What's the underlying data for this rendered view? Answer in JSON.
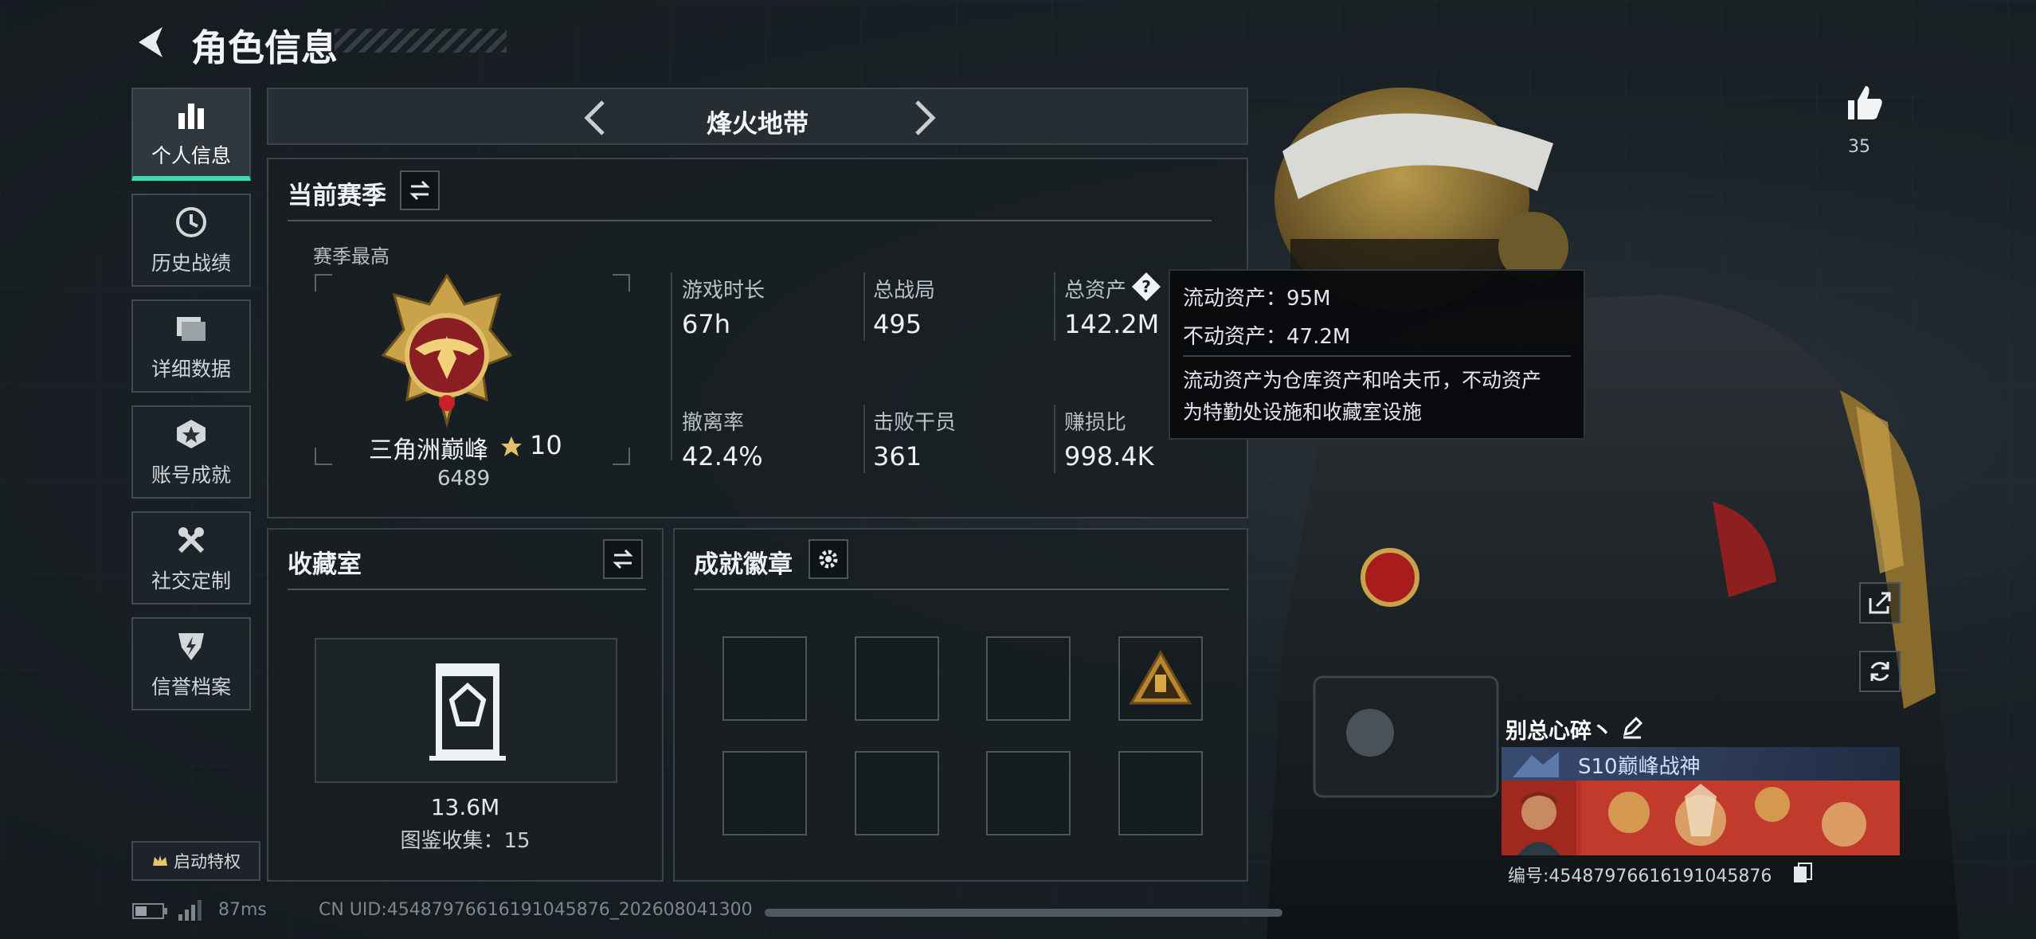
{
  "header": {
    "title": "角色信息"
  },
  "sidebar": {
    "items": [
      {
        "label": "个人信息",
        "icon": "bar-chart-icon",
        "active": true
      },
      {
        "label": "历史战绩",
        "icon": "history-clock-icon",
        "active": false
      },
      {
        "label": "详细数据",
        "icon": "folder-icon",
        "active": false
      },
      {
        "label": "账号成就",
        "icon": "achievement-icon",
        "active": false
      },
      {
        "label": "社交定制",
        "icon": "tools-icon",
        "active": false
      },
      {
        "label": "信誉档案",
        "icon": "shield-icon",
        "active": false
      }
    ],
    "privilege_label": "启动特权"
  },
  "mode_bar": {
    "label": "烽火地带"
  },
  "season": {
    "title": "当前赛季",
    "best_label": "赛季最高",
    "rank_name": "三角洲巅峰",
    "rank_stars": "10",
    "rank_score": "6489",
    "stats": [
      {
        "label": "游戏时长",
        "value": "67h"
      },
      {
        "label": "总战局",
        "value": "495"
      },
      {
        "label": "总资产",
        "value": "142.2M"
      },
      {
        "label": "撤离率",
        "value": "42.4%"
      },
      {
        "label": "击败干员",
        "value": "361"
      },
      {
        "label": "赚损比",
        "value": "998.4K"
      }
    ]
  },
  "tooltip": {
    "line1": "流动资产：95M",
    "line2": "不动资产：47.2M",
    "desc1": "流动资产为仓库资产和哈夫币，不动资产",
    "desc2": "为特勤处设施和收藏室设施"
  },
  "collection": {
    "title": "收藏室",
    "value": "13.6M",
    "count_label": "图鉴收集：15"
  },
  "badges": {
    "title": "成就徽章"
  },
  "likes": {
    "count": "35"
  },
  "player_card": {
    "name": "别总心碎丶",
    "title": "S10巅峰战神",
    "id_text": "编号:4548797661619104587​6"
  },
  "status_bar": {
    "ping": "87ms",
    "uid": "CN UID:4548797661619104587​6_202608041300"
  },
  "colors": {
    "accent": "#39e0a8",
    "gold": "#c9a24a",
    "panel_border": "#39434a"
  }
}
